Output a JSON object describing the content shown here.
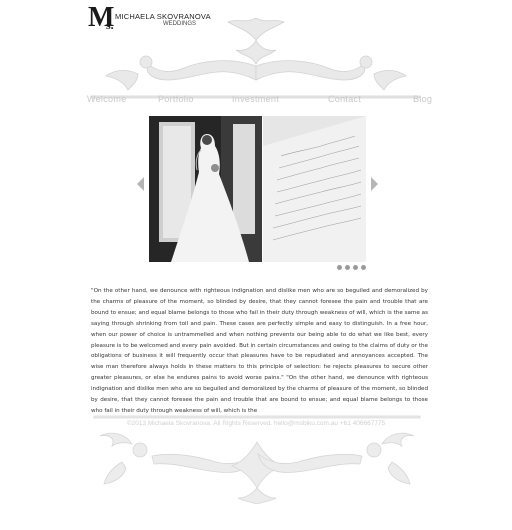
{
  "logo": {
    "monogram": "M",
    "monogram_s": "s.",
    "name": "MICHAELA SKOVRANOVA",
    "subtitle": "WEDDINGS"
  },
  "nav": {
    "items": [
      {
        "label": "Welcome"
      },
      {
        "label": "Portfolio"
      },
      {
        "label": "Investment"
      },
      {
        "label": "Contact"
      },
      {
        "label": "Blog"
      }
    ]
  },
  "slideshow": {
    "total_slides": 4,
    "active_index": 0
  },
  "content": {
    "paragraph": "\"On the other hand, we denounce with righteous indignation and dislike men who are so beguiled and demoralized by the charms of pleasure of the moment, so blinded by desire, that they cannot foresee the pain and trouble that are bound to ensue; and equal blame belongs to those who fail in their duty through weakness of will, which is the same as saying through shrinking from toil and pain. These cases are perfectly simple and easy to distinguish. In a free hour, when our power of choice is untrammelled and when nothing prevents our being able to do what we like best, every pleasure is to be welcomed and every pain avoided. But in certain circumstances and owing to the claims of duty or the obligations of business it will frequently occur that pleasures have to be repudiated and annoyances accepted. The wise man therefore always holds in these matters to this principle of selection: he rejects pleasures to secure other greater pleasures, or else he endures pains to avoid worse pains.\" \"On the other hand, we denounce with righteous indignation and dislike men who are so beguiled and demoralized by the charms of pleasure of the moment, so blinded by desire, that they cannot foresee the pain and trouble that are bound to ensue; and equal blame belongs to those who fail in their duty through weakness of will, which is the"
  },
  "footer": {
    "text": "©2013 Michaela Skovranova. All Rights Reserved. hello@msbiku.com.au +61 406667775"
  },
  "colors": {
    "nav_text": "#c8c8c8",
    "ornament": "#e6e6e6",
    "ornament_edge": "#cfcfcf",
    "dot": "#9a9a9a",
    "arrow": "#b5b5b5"
  }
}
